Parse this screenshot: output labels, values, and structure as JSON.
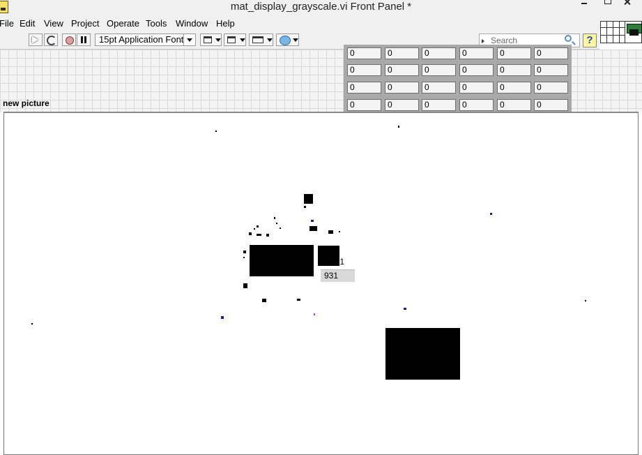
{
  "window": {
    "title": "mat_display_grayscale.vi Front Panel *"
  },
  "menu": [
    "File",
    "Edit",
    "View",
    "Project",
    "Operate",
    "Tools",
    "Window",
    "Help"
  ],
  "toolbar": {
    "font_select": "15pt Application Font",
    "search_placeholder": "Search",
    "help_glyph": "?"
  },
  "matrix": {
    "rows": [
      [
        "0",
        "0",
        "0",
        "0",
        "0",
        "0"
      ],
      [
        "0",
        "0",
        "0",
        "0",
        "0",
        "0"
      ],
      [
        "0",
        "0",
        "0",
        "0",
        "0",
        "0"
      ],
      [
        "0",
        "0",
        "0",
        "0",
        "0",
        "0"
      ]
    ]
  },
  "picture": {
    "label": "new picture"
  },
  "cursor_indicator": {
    "label": "ut 1",
    "value": "931"
  },
  "colors": {
    "panel_grid_bg": "#f4f4f4",
    "blob": "#000000",
    "blob_blue": "#1e1e8c",
    "blob_purple": "#b040e0"
  }
}
